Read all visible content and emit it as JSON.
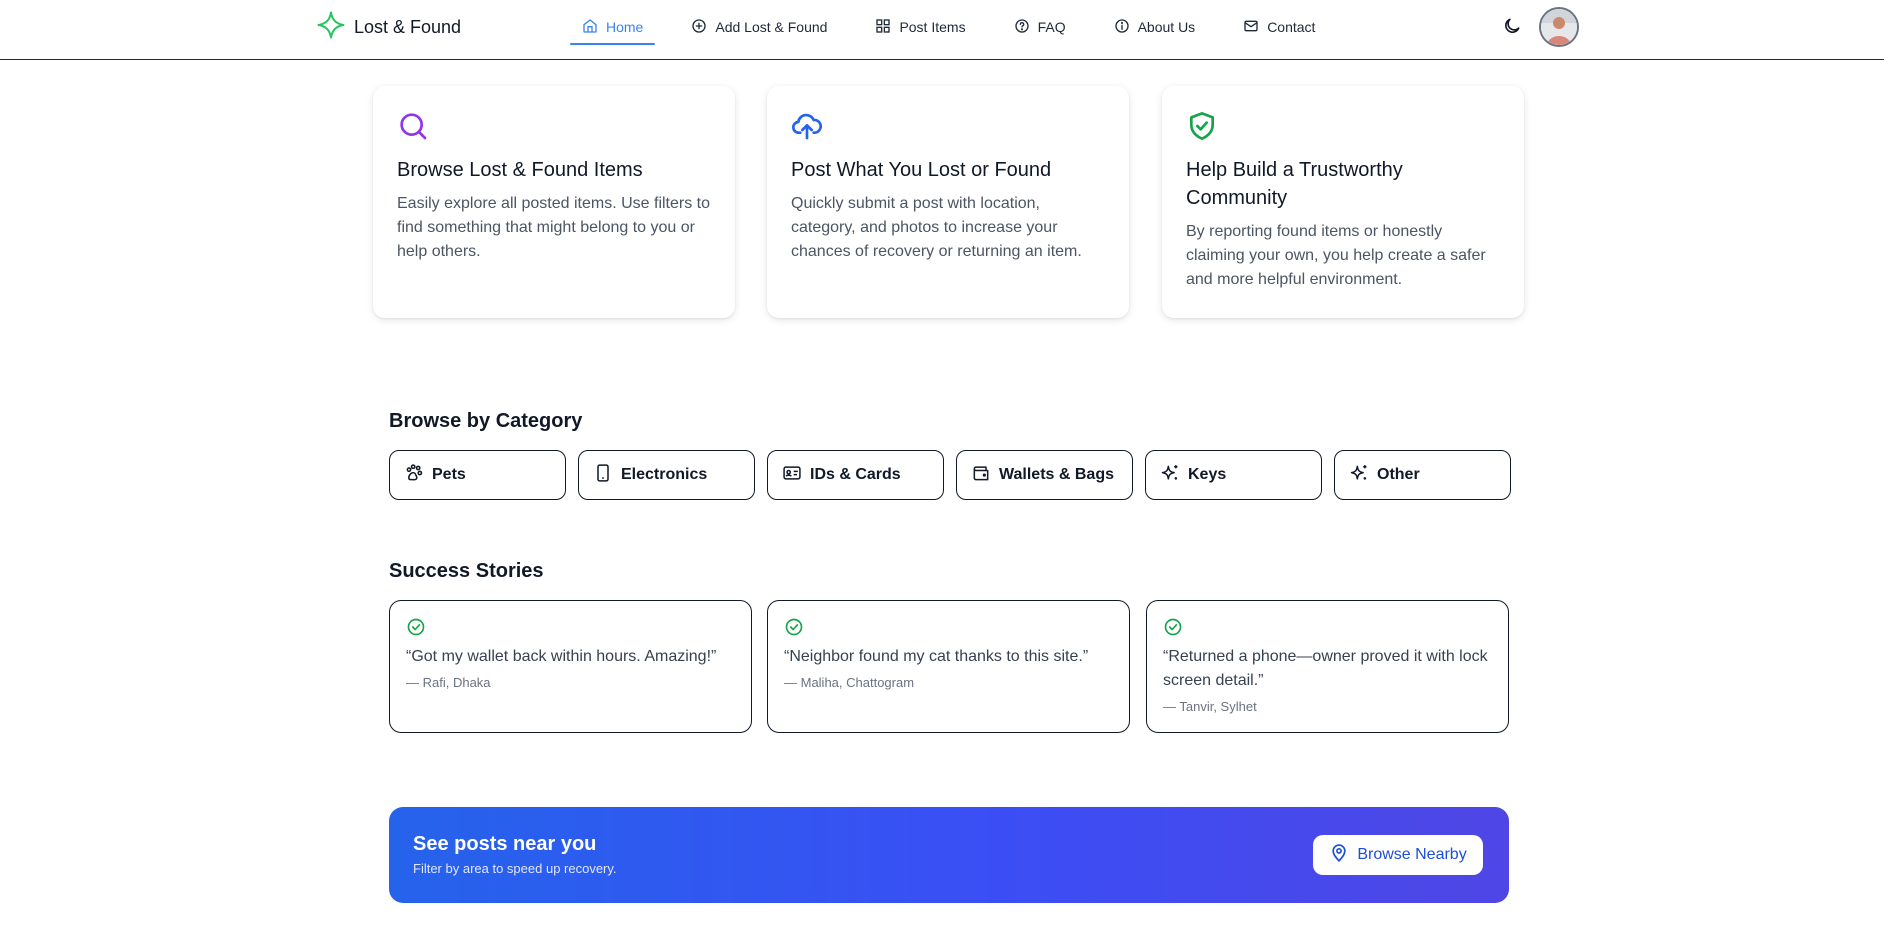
{
  "brand": {
    "name": "Lost & Found",
    "icon": "sparkle-plus-icon",
    "color": "#22c55e"
  },
  "nav": {
    "items": [
      {
        "label": "Home",
        "icon": "home-icon",
        "active": true
      },
      {
        "label": "Add Lost & Found",
        "icon": "plus-circle-icon"
      },
      {
        "label": "Post Items",
        "icon": "grid-icon"
      },
      {
        "label": "FAQ",
        "icon": "help-circle-icon"
      },
      {
        "label": "About Us",
        "icon": "info-icon"
      },
      {
        "label": "Contact",
        "icon": "mail-icon"
      }
    ],
    "active_color": "#3b82f6"
  },
  "header": {
    "theme_toggle_icon": "moon-icon",
    "avatar_icon": "user-avatar"
  },
  "features": [
    {
      "icon": "search-icon",
      "icon_color": "#9333ea",
      "title": "Browse Lost & Found Items",
      "desc": "Easily explore all posted items. Use filters to find something that might belong to you or help others."
    },
    {
      "icon": "cloud-upload-icon",
      "icon_color": "#2563eb",
      "title": "Post What You Lost or Found",
      "desc": "Quickly submit a post with location, category, and photos to increase your chances of recovery or returning an item."
    },
    {
      "icon": "shield-check-icon",
      "icon_color": "#16a34a",
      "title": "Help Build a Trustworthy Community",
      "desc": "By reporting found items or honestly claiming your own, you help create a safer and more helpful environment."
    }
  ],
  "categories": {
    "title": "Browse by Category",
    "items": [
      {
        "label": "Pets",
        "icon": "paw-icon"
      },
      {
        "label": "Electronics",
        "icon": "smartphone-icon"
      },
      {
        "label": "IDs & Cards",
        "icon": "id-card-icon"
      },
      {
        "label": "Wallets & Bags",
        "icon": "wallet-icon"
      },
      {
        "label": "Keys",
        "icon": "sparkles-icon"
      },
      {
        "label": "Other",
        "icon": "sparkles-icon"
      }
    ]
  },
  "stories": {
    "title": "Success Stories",
    "items": [
      {
        "quote": "“Got my wallet back within hours. Amazing!”",
        "author": "— Rafi, Dhaka"
      },
      {
        "quote": "“Neighbor found my cat thanks to this site.”",
        "author": "— Maliha, Chattogram"
      },
      {
        "quote": "“Returned a phone—owner proved it with lock screen detail.”",
        "author": "— Tanvir, Sylhet"
      }
    ],
    "check_color": "#16a34a"
  },
  "cta": {
    "title": "See posts near you",
    "subtitle": "Filter by area to speed up recovery.",
    "button_label": "Browse Nearby",
    "button_icon": "map-pin-icon"
  }
}
